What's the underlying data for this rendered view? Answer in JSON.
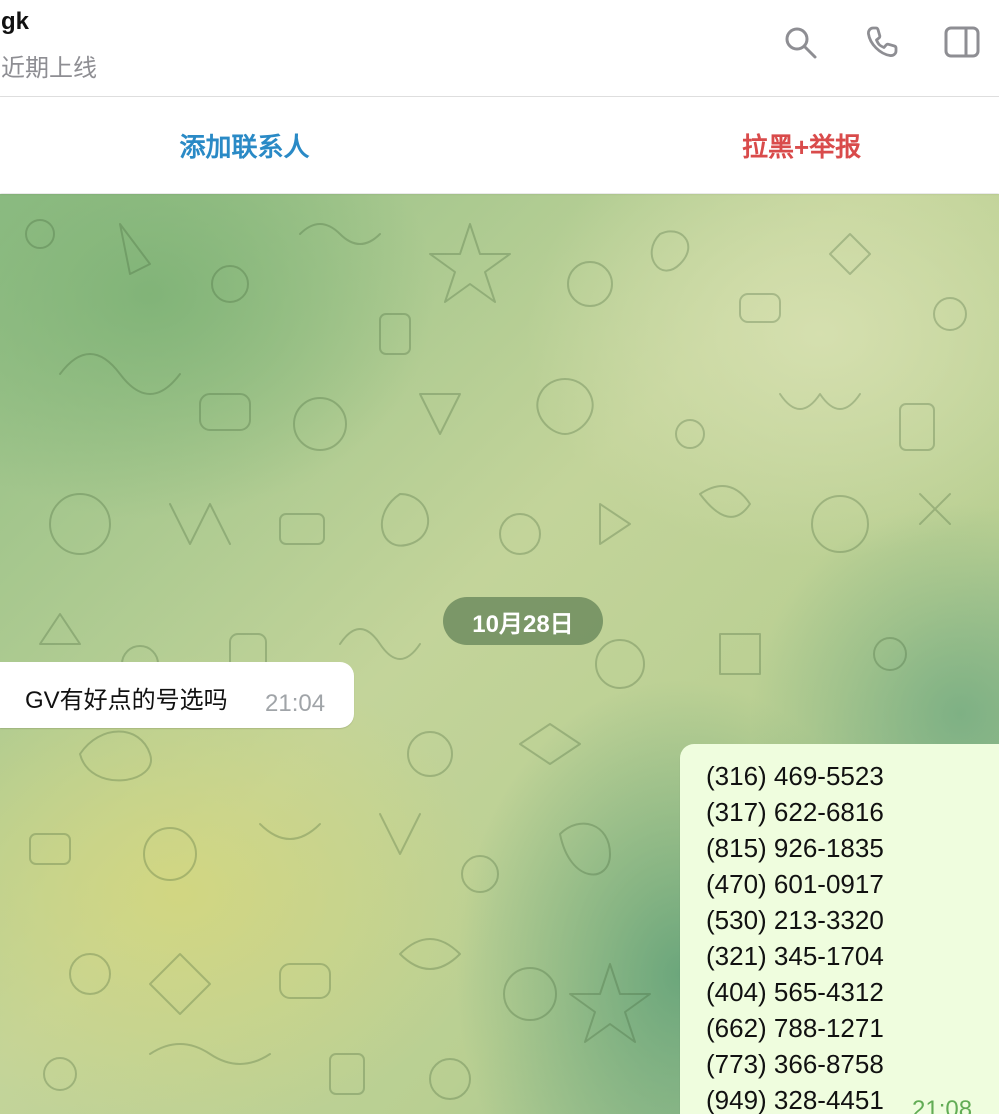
{
  "header": {
    "name": "gk",
    "status": "近期上线"
  },
  "icons": {
    "search": "search-icon",
    "call": "phone-icon",
    "sidebar": "sidebar-toggle-icon"
  },
  "action_bar": {
    "add_contact": "添加联系人",
    "block_report": "拉黑+举报"
  },
  "chat": {
    "date_label": "10月28日",
    "incoming": {
      "text": "GV有好点的号选吗",
      "time": "21:04"
    },
    "outgoing": {
      "lines": [
        "(316) 469-5523",
        "(317) 622-6816",
        "(815) 926-1835",
        "(470) 601-0917",
        "(530) 213-3320",
        "(321) 345-1704",
        "(404) 565-4312",
        "(662) 788-1271",
        "(773) 366-8758",
        "(949) 328-4451"
      ],
      "time": "21:08"
    }
  },
  "colors": {
    "accent_blue": "#2a8ac6",
    "danger_red": "#d94b4b",
    "outgoing_bubble": "#effdde",
    "outgoing_time": "#62ac55"
  }
}
